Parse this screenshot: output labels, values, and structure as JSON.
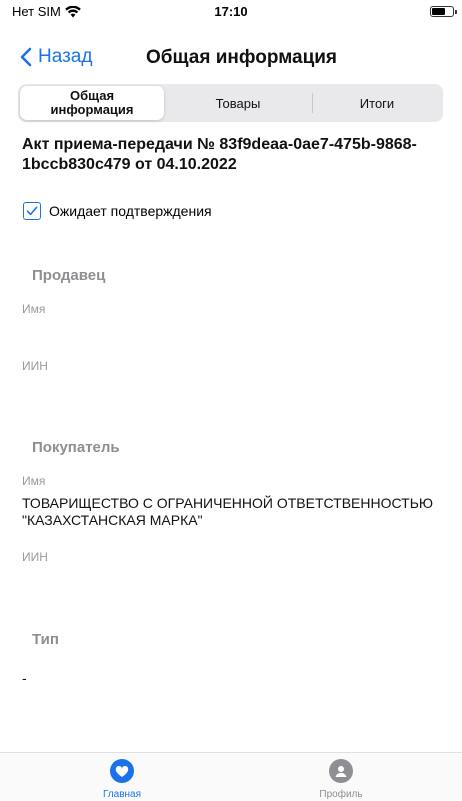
{
  "status_bar": {
    "carrier": "Нет SIM",
    "time": "17:10"
  },
  "nav": {
    "back_label": "Назад",
    "title": "Общая информация"
  },
  "segments": [
    {
      "label": "Общая информация",
      "active": true
    },
    {
      "label": "Товары",
      "active": false
    },
    {
      "label": "Итоги",
      "active": false
    }
  ],
  "document": {
    "title": "Акт приема-передачи № 83f9deaa-0ae7-475b-9868-1bccb830c479 от 04.10.2022",
    "status_label": "Ожидает подтверждения",
    "status_checked": true
  },
  "seller": {
    "header": "Продавец",
    "name_label": "Имя",
    "name_value": "",
    "iin_label": "ИИН",
    "iin_value": ""
  },
  "buyer": {
    "header": "Покупатель",
    "name_label": "Имя",
    "name_value": "ТОВАРИЩЕСТВО С ОГРАНИЧЕННОЙ ОТВЕТСТВЕННОСТЬЮ \"КАЗАХСТАНСКАЯ МАРКА\"",
    "iin_label": "ИИН",
    "iin_value": ""
  },
  "type_section": {
    "header": "Тип",
    "value": "-"
  },
  "tab_bar": {
    "tabs": [
      {
        "label": "Главная",
        "icon": "heart-icon",
        "active": true
      },
      {
        "label": "Профиль",
        "icon": "person-icon",
        "active": false
      }
    ]
  },
  "colors": {
    "accent": "#1a73e8",
    "inactive": "#8e8e93"
  }
}
